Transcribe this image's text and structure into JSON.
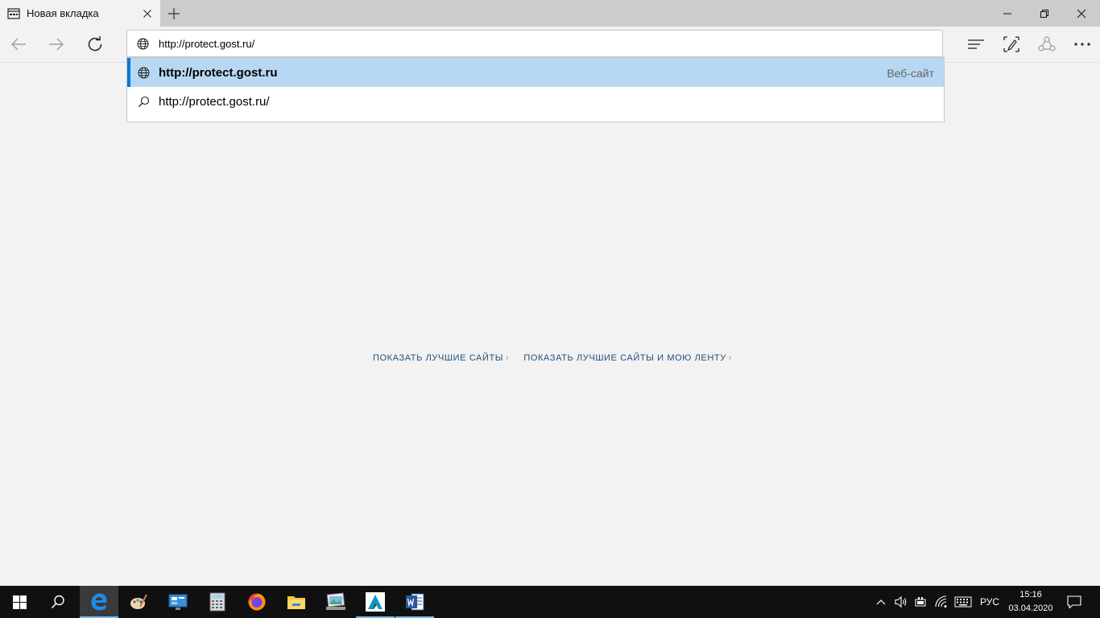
{
  "tab": {
    "title": "Новая вкладка"
  },
  "address_bar": {
    "value": "http://protect.gost.ru/"
  },
  "suggestions": [
    {
      "text": "http://protect.gost.ru",
      "type": "Веб-сайт",
      "icon": "globe-icon"
    },
    {
      "text": "http://protect.gost.ru/",
      "type": "",
      "icon": "search-icon"
    }
  ],
  "center_links": {
    "top_sites": "ПОКАЗАТЬ ЛУЧШИЕ САЙТЫ",
    "top_sites_feed": "ПОКАЗАТЬ ЛУЧШИЕ САЙТЫ И МОЮ ЛЕНТУ"
  },
  "taskbar": {
    "language": "РУС",
    "time": "15:16",
    "date": "03.04.2020",
    "apps": [
      "start",
      "search",
      "edge",
      "paint",
      "control-panel",
      "calculator",
      "firefox",
      "file-explorer",
      "photos",
      "autocad",
      "word"
    ]
  },
  "colors": {
    "accent": "#0078d7",
    "selected_suggestion": "#b7d7f2",
    "link": "#1e4f7a",
    "taskbar": "#101010"
  }
}
